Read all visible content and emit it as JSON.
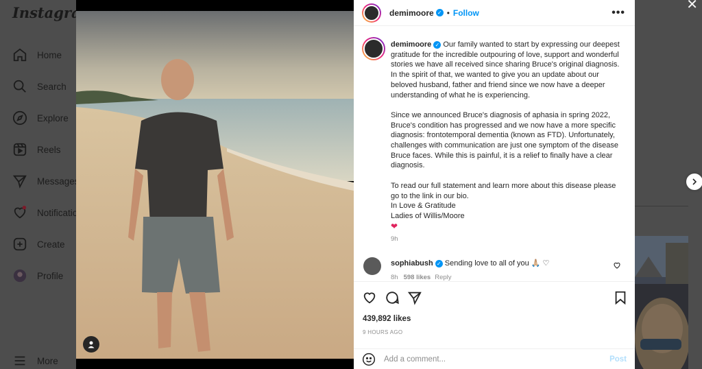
{
  "app": {
    "logo_text": "Instagram"
  },
  "sidebar": {
    "items": [
      {
        "label": "Home",
        "icon": "home-icon"
      },
      {
        "label": "Search",
        "icon": "search-icon"
      },
      {
        "label": "Explore",
        "icon": "compass-icon"
      },
      {
        "label": "Reels",
        "icon": "reels-icon"
      },
      {
        "label": "Messages",
        "icon": "send-icon"
      },
      {
        "label": "Notifications",
        "icon": "heart-icon"
      },
      {
        "label": "Create",
        "icon": "plus-square-icon"
      },
      {
        "label": "Profile",
        "icon": "profile-avatar"
      }
    ],
    "more_label": "More"
  },
  "post": {
    "author": "demimoore",
    "follow_label": "Follow",
    "more_glyph": "•••",
    "caption_paragraphs": [
      [
        "Our family wanted to start by expressing our deepest gratitude for the incredible outpouring of love, support and wonderful stories we have all received since sharing Bruce's original diagnosis. In the spirit of that, we wanted to give you an update about our beloved husband, father and friend since we now have a deeper understanding of what he is experiencing."
      ],
      [
        "Since we announced Bruce's diagnosis of aphasia in spring 2022, Bruce's condition has progressed and we now have a more specific diagnosis: frontotemporal dementia (known as FTD). Unfortunately, challenges with communication are just one symptom of the disease Bruce faces. While this is painful, it is a relief to finally have a clear diagnosis."
      ],
      [
        "To read our full statement and learn more about this disease please go to the link in our bio.",
        "In Love & Gratitude",
        "Ladies of Willis/Moore"
      ]
    ],
    "caption_p1": "Our family wanted to start by expressing our deepest gratitude for the incredible outpouring of love, support and wonderful stories we have all received since sharing Bruce's original diagnosis. In the spirit of that, we wanted to give you an update about our beloved husband, father and friend since we now have a deeper understanding of what he is experiencing.",
    "caption_p2": "Since we announced Bruce's diagnosis of aphasia in spring 2022, Bruce's condition has progressed and we now have a more specific diagnosis: frontotemporal dementia (known as FTD). Unfortunately, challenges with communication are just one symptom of the disease Bruce faces. While this is painful, it is a relief to finally have a clear diagnosis.",
    "caption_p3_line1": "To read our full statement and learn more about this disease please go to the link in our bio.",
    "caption_p3_line2": "In Love & Gratitude",
    "caption_p3_line3": "Ladies of Willis/Moore",
    "caption_emoji": "❤",
    "caption_time": "9h",
    "likes": "439,892 likes",
    "post_time": "9 HOURS AGO"
  },
  "comment": {
    "author": "sophiabush",
    "text": "Sending love to all of you 🙏🏼 ♡",
    "time": "8h",
    "likes": "598 likes",
    "reply_label": "Reply"
  },
  "add_comment": {
    "placeholder": "Add a comment...",
    "post_label": "Post"
  },
  "colors": {
    "accent": "#0095f6",
    "post_disabled": "#b2dffc",
    "heart": "#e0245e"
  }
}
